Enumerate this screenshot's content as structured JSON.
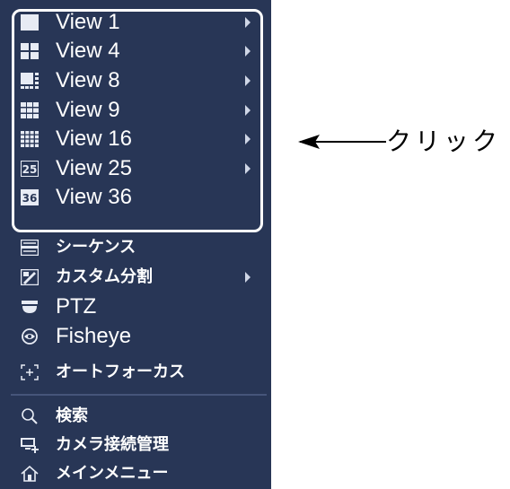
{
  "view_items": [
    {
      "label": "View 1",
      "icon": "view-1-icon",
      "submenu": true
    },
    {
      "label": "View 4",
      "icon": "view-4-icon",
      "submenu": true
    },
    {
      "label": "View 8",
      "icon": "view-8-icon",
      "submenu": true
    },
    {
      "label": "View 9",
      "icon": "view-9-icon",
      "submenu": true
    },
    {
      "label": "View 16",
      "icon": "view-16-icon",
      "submenu": true
    },
    {
      "label": "View 25",
      "icon": "view-25-icon",
      "badge": "25",
      "submenu": true
    },
    {
      "label": "View 36",
      "icon": "view-36-icon",
      "badge": "36",
      "submenu": false
    }
  ],
  "other_items": [
    {
      "label": "シーケンス",
      "icon": "sequence-icon"
    },
    {
      "label": "カスタム分割",
      "icon": "custom-split-icon",
      "submenu": true
    },
    {
      "label": "PTZ",
      "icon": "ptz-icon"
    },
    {
      "label": "Fisheye",
      "icon": "fisheye-icon"
    },
    {
      "label": "オートフォーカス",
      "icon": "autofocus-icon"
    }
  ],
  "bottom_items": [
    {
      "label": "検索",
      "icon": "search-icon"
    },
    {
      "label": "カメラ接続管理",
      "icon": "camera-registration-icon"
    },
    {
      "label": "メインメニュー",
      "icon": "home-icon"
    }
  ],
  "annotation": {
    "text": "クリック"
  },
  "colors": {
    "menu_bg": "#283656",
    "text": "#ffffff",
    "icon": "#e7ebf4",
    "divider": "#46557a"
  }
}
